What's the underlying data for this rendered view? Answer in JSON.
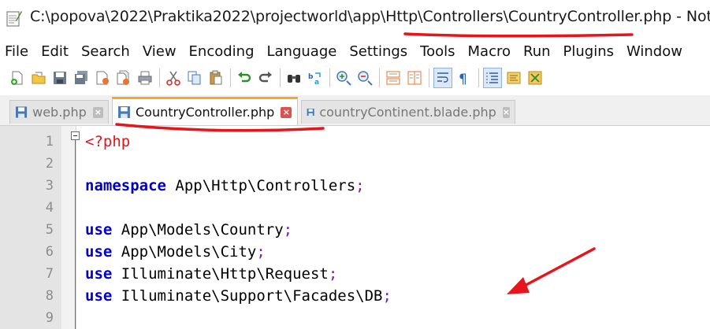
{
  "window": {
    "title": "C:\\popova\\2022\\Praktika2022\\projectworld\\app\\Http\\Controllers\\CountryController.php - Notepad++"
  },
  "menu": [
    "File",
    "Edit",
    "Search",
    "View",
    "Encoding",
    "Language",
    "Settings",
    "Tools",
    "Macro",
    "Run",
    "Plugins",
    "Window"
  ],
  "toolbar": {
    "icons": [
      "new-file-icon",
      "open-file-icon",
      "save-icon",
      "save-all-icon",
      "close-icon",
      "close-all-icon",
      "print-icon",
      "cut-icon",
      "copy-icon",
      "paste-icon",
      "undo-icon",
      "redo-icon",
      "find-icon",
      "replace-icon",
      "zoom-in-icon",
      "zoom-out-icon",
      "sync-vertical-icon",
      "sync-horizontal-icon",
      "word-wrap-icon",
      "show-all-chars-icon",
      "indent-guide-icon",
      "doc-map-icon",
      "function-list-icon"
    ]
  },
  "tabs": [
    {
      "label": "web.php",
      "active": false
    },
    {
      "label": "CountryController.php",
      "active": true
    },
    {
      "label": "countryContinent.blade.php",
      "active": false
    }
  ],
  "editor": {
    "lines": [
      {
        "num": "1",
        "tag": "<?php"
      },
      {
        "num": "2"
      },
      {
        "num": "3",
        "keyword": "namespace",
        "text": " App\\Http\\Controllers",
        "end": ";"
      },
      {
        "num": "4"
      },
      {
        "num": "5",
        "keyword": "use",
        "text": " App\\Models\\Country",
        "end": ";"
      },
      {
        "num": "6",
        "keyword": "use",
        "text": " App\\Models\\City",
        "end": ";"
      },
      {
        "num": "7",
        "keyword": "use",
        "text": " Illuminate\\Http\\Request",
        "end": ";"
      },
      {
        "num": "8",
        "keyword": "use",
        "text": " Illuminate\\Support\\Facades\\DB",
        "end": ";"
      },
      {
        "num": "9"
      }
    ]
  },
  "colors": {
    "keyword": "#0000c8",
    "php_tag": "#e0161a",
    "punctuation": "#7a1fa2",
    "annotation_red": "#e8141c",
    "active_tab_accent": "#f5a623"
  }
}
